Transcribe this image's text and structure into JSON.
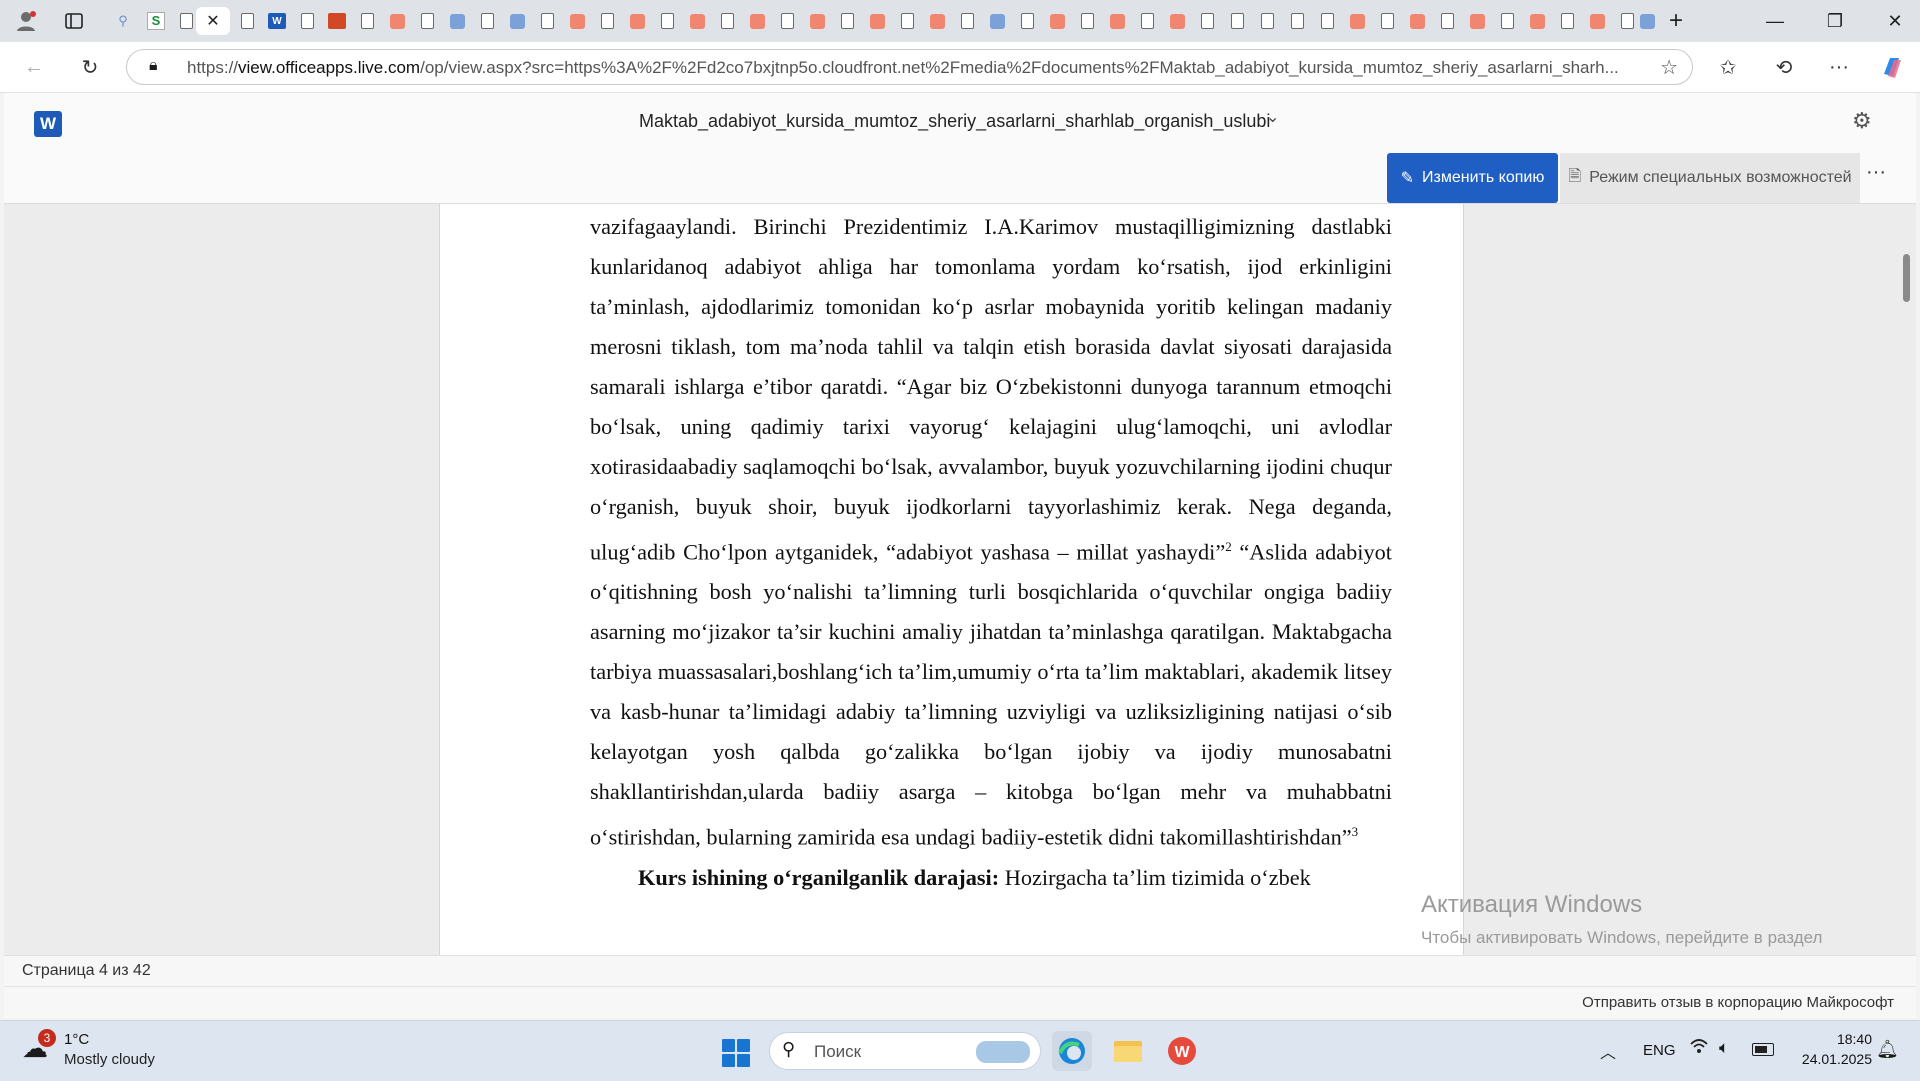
{
  "browser": {
    "url_prefix": "https://",
    "url_host": "view.officeapps.live.com",
    "url_rest": "/op/view.aspx?src=https%3A%2F%2Fd2co7bxjtnp5o.cloudfront.net%2Fmedia%2Fdocuments%2FMaktab_adabiyot_kursida_mumtoz_sheriy_asarlarni_sharh..."
  },
  "viewer": {
    "doc_title": "Maktab_adabiyot_kursida_mumtoz_sheriy_asarlarni_sharhlab_organish_uslubi",
    "edit_button": "Изменить копию",
    "accessibility_button": "Режим специальных возможностей",
    "page_indicator": "Страница 4 из 42",
    "feedback": "Отправить отзыв в корпорацию Майкрософт"
  },
  "document": {
    "para1_lines": [
      "vazifagaaylandi. Birinchi Prezidentimiz I.A.Karimov mustaqilligimizning",
      "dastlabki kunlaridanoq adabiyot ahliga har tomonlama yordam ko‘rsatish, ijod",
      "erkinligini ta’minlash, ajdodlarimiz tomonidan ko‘p asrlar mobaynida yoritib",
      "kelingan madaniy merosni tiklash, tom ma’noda tahlil va talqin etish borasida",
      "davlat siyosati darajasida samarali ishlarga e’tibor qaratdi. “Agar biz O‘zbekistonni",
      "dunyoga tarannum etmoqchi bo‘lsak, uning qadimiy tarixi vayorug‘ kelajagini",
      "ulug‘lamoqchi, uni avlodlar xotirasidaabadiy saqlamoqchi bo‘lsak, avvalambor,",
      "buyuk yozuvchilarning ijodini chuqur o‘rganish, buyuk shoir, buyuk ijodkorlarni",
      "tayyorlashimiz kerak. Nega deganda, ulug‘adib Cho‘lpon aytganidek, “adabiyot"
    ],
    "line_yashasa": "yashasa – millat yashaydi”",
    "sup2": "2",
    "line_yashasa_rest": " “Aslida adabiyot o‘qitishning bosh yo‘nalishi",
    "para1_lines_b": [
      "ta’limning turli bosqichlarida o‘quvchilar ongiga badiiy asarning mo‘jizakor ta’sir",
      "kuchini amaliy jihatdan ta’minlashga qaratilgan. Maktabgacha tarbiya",
      "muassasalari,boshlang‘ich ta’lim,umumiy o‘rta ta’lim maktablari, akademik litsey",
      "va kasb-hunar ta’limidagi adabiy ta’limning uzviyligi va uzliksizligining natijasi",
      "o‘sib kelayotgan yosh qalbda go‘zalikka bo‘lgan ijobiy va ijodiy munosabatni",
      "shakllantirishdan,ularda badiiy asarga – kitobga bo‘lgan mehr va muhabbatni",
      "o‘stirishdan, bularning zamirida esa undagi badiiy-estetik didni"
    ],
    "last_line": "takomillashtirishdan”",
    "sup3": "3",
    "para2_bold": "Kurs ishining o‘rganilganlik darajasi:",
    "para2_rest": " Hozirgacha ta’lim tizimida o‘zbek"
  },
  "watermark": {
    "title": "Активация Windows",
    "subtitle": "Чтобы активировать Windows, перейдите в раздел \"Параметры\"."
  },
  "taskbar": {
    "weather_badge": "3",
    "temperature": "1°C",
    "condition": "Mostly cloudy",
    "search_placeholder": "Поиск",
    "language": "ENG",
    "time": "18:40",
    "date": "24.01.2025"
  },
  "icons": {
    "profile": "profile-icon",
    "tabs": "tab-actions-icon",
    "lock": "lock-icon",
    "star": "favorite-icon",
    "refresh": "refresh-icon",
    "back": "back-icon",
    "settings": "gear-icon",
    "pencil": "pencil-icon"
  },
  "colors": {
    "edit_button": "#1f5fc4",
    "word_brand": "#1e5bb8",
    "tabbar": "#dfe3e8",
    "taskbar": "#dde6f0"
  }
}
